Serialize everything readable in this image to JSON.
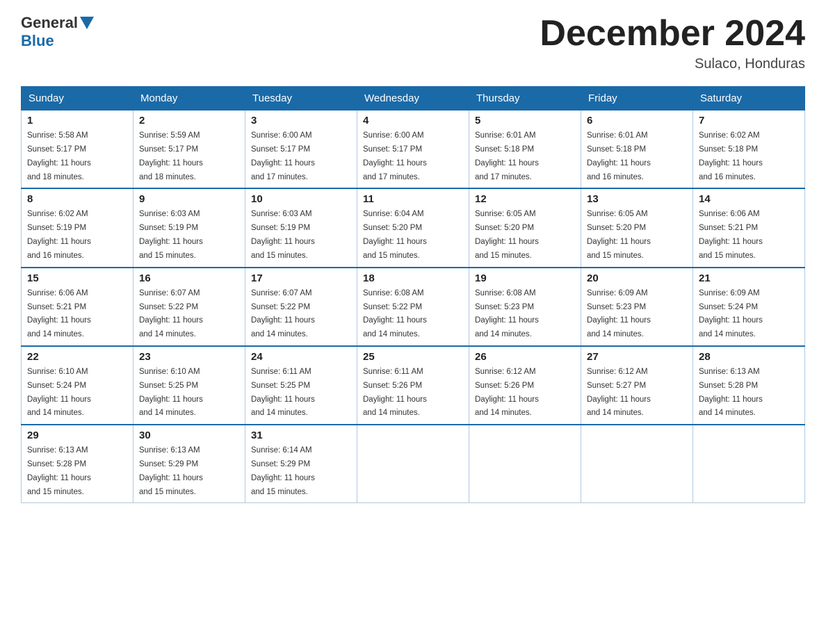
{
  "header": {
    "logo_general": "General",
    "logo_blue": "Blue",
    "month_title": "December 2024",
    "location": "Sulaco, Honduras"
  },
  "days_of_week": [
    "Sunday",
    "Monday",
    "Tuesday",
    "Wednesday",
    "Thursday",
    "Friday",
    "Saturday"
  ],
  "weeks": [
    [
      {
        "day": "1",
        "sunrise": "5:58 AM",
        "sunset": "5:17 PM",
        "daylight": "11 hours and 18 minutes."
      },
      {
        "day": "2",
        "sunrise": "5:59 AM",
        "sunset": "5:17 PM",
        "daylight": "11 hours and 18 minutes."
      },
      {
        "day": "3",
        "sunrise": "6:00 AM",
        "sunset": "5:17 PM",
        "daylight": "11 hours and 17 minutes."
      },
      {
        "day": "4",
        "sunrise": "6:00 AM",
        "sunset": "5:17 PM",
        "daylight": "11 hours and 17 minutes."
      },
      {
        "day": "5",
        "sunrise": "6:01 AM",
        "sunset": "5:18 PM",
        "daylight": "11 hours and 17 minutes."
      },
      {
        "day": "6",
        "sunrise": "6:01 AM",
        "sunset": "5:18 PM",
        "daylight": "11 hours and 16 minutes."
      },
      {
        "day": "7",
        "sunrise": "6:02 AM",
        "sunset": "5:18 PM",
        "daylight": "11 hours and 16 minutes."
      }
    ],
    [
      {
        "day": "8",
        "sunrise": "6:02 AM",
        "sunset": "5:19 PM",
        "daylight": "11 hours and 16 minutes."
      },
      {
        "day": "9",
        "sunrise": "6:03 AM",
        "sunset": "5:19 PM",
        "daylight": "11 hours and 15 minutes."
      },
      {
        "day": "10",
        "sunrise": "6:03 AM",
        "sunset": "5:19 PM",
        "daylight": "11 hours and 15 minutes."
      },
      {
        "day": "11",
        "sunrise": "6:04 AM",
        "sunset": "5:20 PM",
        "daylight": "11 hours and 15 minutes."
      },
      {
        "day": "12",
        "sunrise": "6:05 AM",
        "sunset": "5:20 PM",
        "daylight": "11 hours and 15 minutes."
      },
      {
        "day": "13",
        "sunrise": "6:05 AM",
        "sunset": "5:20 PM",
        "daylight": "11 hours and 15 minutes."
      },
      {
        "day": "14",
        "sunrise": "6:06 AM",
        "sunset": "5:21 PM",
        "daylight": "11 hours and 15 minutes."
      }
    ],
    [
      {
        "day": "15",
        "sunrise": "6:06 AM",
        "sunset": "5:21 PM",
        "daylight": "11 hours and 14 minutes."
      },
      {
        "day": "16",
        "sunrise": "6:07 AM",
        "sunset": "5:22 PM",
        "daylight": "11 hours and 14 minutes."
      },
      {
        "day": "17",
        "sunrise": "6:07 AM",
        "sunset": "5:22 PM",
        "daylight": "11 hours and 14 minutes."
      },
      {
        "day": "18",
        "sunrise": "6:08 AM",
        "sunset": "5:22 PM",
        "daylight": "11 hours and 14 minutes."
      },
      {
        "day": "19",
        "sunrise": "6:08 AM",
        "sunset": "5:23 PM",
        "daylight": "11 hours and 14 minutes."
      },
      {
        "day": "20",
        "sunrise": "6:09 AM",
        "sunset": "5:23 PM",
        "daylight": "11 hours and 14 minutes."
      },
      {
        "day": "21",
        "sunrise": "6:09 AM",
        "sunset": "5:24 PM",
        "daylight": "11 hours and 14 minutes."
      }
    ],
    [
      {
        "day": "22",
        "sunrise": "6:10 AM",
        "sunset": "5:24 PM",
        "daylight": "11 hours and 14 minutes."
      },
      {
        "day": "23",
        "sunrise": "6:10 AM",
        "sunset": "5:25 PM",
        "daylight": "11 hours and 14 minutes."
      },
      {
        "day": "24",
        "sunrise": "6:11 AM",
        "sunset": "5:25 PM",
        "daylight": "11 hours and 14 minutes."
      },
      {
        "day": "25",
        "sunrise": "6:11 AM",
        "sunset": "5:26 PM",
        "daylight": "11 hours and 14 minutes."
      },
      {
        "day": "26",
        "sunrise": "6:12 AM",
        "sunset": "5:26 PM",
        "daylight": "11 hours and 14 minutes."
      },
      {
        "day": "27",
        "sunrise": "6:12 AM",
        "sunset": "5:27 PM",
        "daylight": "11 hours and 14 minutes."
      },
      {
        "day": "28",
        "sunrise": "6:13 AM",
        "sunset": "5:28 PM",
        "daylight": "11 hours and 14 minutes."
      }
    ],
    [
      {
        "day": "29",
        "sunrise": "6:13 AM",
        "sunset": "5:28 PM",
        "daylight": "11 hours and 15 minutes."
      },
      {
        "day": "30",
        "sunrise": "6:13 AM",
        "sunset": "5:29 PM",
        "daylight": "11 hours and 15 minutes."
      },
      {
        "day": "31",
        "sunrise": "6:14 AM",
        "sunset": "5:29 PM",
        "daylight": "11 hours and 15 minutes."
      },
      null,
      null,
      null,
      null
    ]
  ],
  "sunrise_label": "Sunrise:",
  "sunset_label": "Sunset:",
  "daylight_label": "Daylight:"
}
